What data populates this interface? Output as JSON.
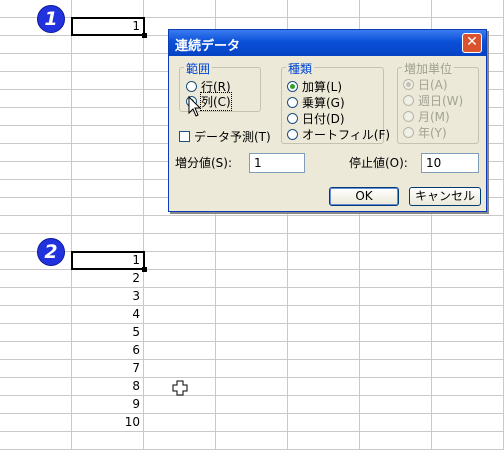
{
  "step_badges": [
    "1",
    "2"
  ],
  "sheet": {
    "top_cell_value": "1",
    "series_values": [
      "1",
      "2",
      "3",
      "4",
      "5",
      "6",
      "7",
      "8",
      "9",
      "10"
    ]
  },
  "dialog": {
    "title": "連続データ",
    "close_glyph": "✕",
    "range_group": {
      "title": "範囲",
      "options": [
        {
          "label": "行(R)",
          "selected": false
        },
        {
          "label": "列(C)",
          "selected": true
        }
      ]
    },
    "type_group": {
      "title": "種類",
      "options": [
        {
          "label": "加算(L)",
          "selected": true
        },
        {
          "label": "乗算(G)",
          "selected": false
        },
        {
          "label": "日付(D)",
          "selected": false
        },
        {
          "label": "オートフィル(F)",
          "selected": false
        }
      ]
    },
    "unit_group": {
      "title": "増加単位",
      "options": [
        {
          "label": "日(A)",
          "selected": true
        },
        {
          "label": "週日(W)",
          "selected": false
        },
        {
          "label": "月(M)",
          "selected": false
        },
        {
          "label": "年(Y)",
          "selected": false
        }
      ]
    },
    "trend_checkbox": {
      "label": "データ予測(T)",
      "checked": false
    },
    "step_value": {
      "label": "増分値(S):",
      "value": "1"
    },
    "stop_value": {
      "label": "停止値(O):",
      "value": "10"
    },
    "ok_label": "OK",
    "cancel_label": "キャンセル"
  },
  "icons": {
    "mouse_cursor": "arrow-pointer-icon",
    "excel_cursor": "cross-cursor-icon"
  },
  "colors": {
    "title_bar": "#0a50d8",
    "dialog_bg": "#ece9d8",
    "group_title": "#0046d5",
    "badge": "#2233dd"
  }
}
